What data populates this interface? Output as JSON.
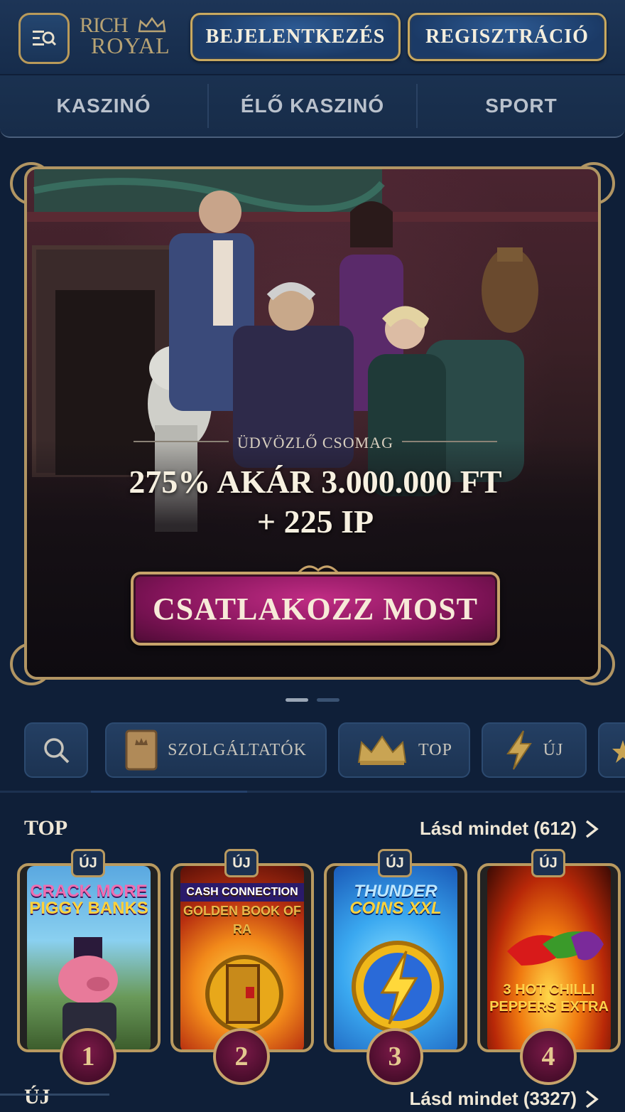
{
  "header": {
    "logo_line1": "RICH",
    "logo_line2": "ROYAL",
    "login_label": "BEJELENTKEZÉS",
    "register_label": "REGISZTRÁCIÓ"
  },
  "nav": {
    "items": [
      {
        "label": "KASZINÓ"
      },
      {
        "label": "ÉLŐ KASZINÓ"
      },
      {
        "label": "SPORT"
      }
    ]
  },
  "hero": {
    "subtitle": "ÜDVÖZLŐ CSOMAG",
    "title_line1": "275% AKÁR 3.000.000 FT",
    "title_line2": "+ 225 IP",
    "cta_label": "CSATLAKOZZ MOST",
    "slides": 2,
    "active_slide": 1
  },
  "filters": {
    "providers_label": "SZOLGÁLTATÓK",
    "top_label": "TOP",
    "new_label": "ÚJ"
  },
  "sections": {
    "top": {
      "title": "TOP",
      "see_all": "Lásd mindet (612)",
      "games": [
        {
          "name_l1": "CRACK MORE",
          "name_l2": "PIGGY BANKS",
          "badge": "ÚJ",
          "rank": "1"
        },
        {
          "name_l1": "CASH CONNECTION",
          "name_l2": "GOLDEN BOOK OF RA",
          "badge": "ÚJ",
          "rank": "2"
        },
        {
          "name_l1": "THUNDER",
          "name_l2": "COINS XXL",
          "badge": "ÚJ",
          "rank": "3"
        },
        {
          "name_l1": "3 HOT CHILLI",
          "name_l2": "PEPPERS EXTRA",
          "badge": "ÚJ",
          "rank": "4"
        }
      ]
    },
    "new": {
      "title": "ÚJ",
      "see_all": "Lásd mindet (3327)"
    }
  },
  "colors": {
    "background": "#0f1f38",
    "gold": "#c9a95f",
    "cta": "#a01f70"
  }
}
